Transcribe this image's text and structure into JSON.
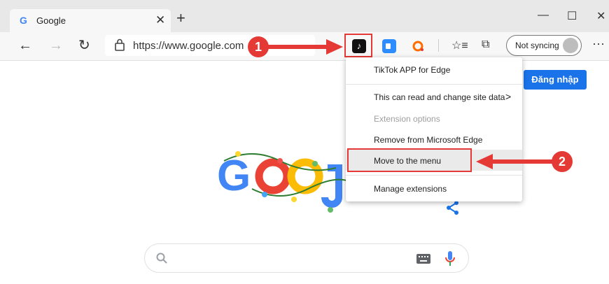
{
  "tab": {
    "favicon": "G",
    "title": "Google",
    "close": "✕"
  },
  "new_tab": "+",
  "window": {
    "minimize": "—",
    "maximize": "☐",
    "close": "✕"
  },
  "nav": {
    "back": "←",
    "forward": "→",
    "refresh": "↻"
  },
  "address": {
    "url": "https://www.google.com"
  },
  "extensions": {
    "tiktok_glyph": "♪"
  },
  "profile": {
    "sync_label": "Not syncing"
  },
  "toolbar": {
    "more": "···",
    "favorites": "☆≡",
    "collections": "⧉"
  },
  "page": {
    "signin_label": "Đăng nhập",
    "logo": "Google"
  },
  "context_menu": {
    "items": [
      {
        "label": "TikTok APP for Edge",
        "disabled": false
      },
      {
        "label": "This can read and change site data",
        "disabled": false
      },
      {
        "label": "Extension options",
        "disabled": true
      },
      {
        "label": "Remove from Microsoft Edge",
        "disabled": false
      },
      {
        "label": "Move to the menu",
        "disabled": false
      },
      {
        "label": "Manage extensions",
        "disabled": false
      }
    ],
    "submenu_arrow": ">"
  },
  "annotations": {
    "step1": "1",
    "step2": "2"
  },
  "colors": {
    "accent": "#e53935",
    "signin": "#1a73e8"
  }
}
